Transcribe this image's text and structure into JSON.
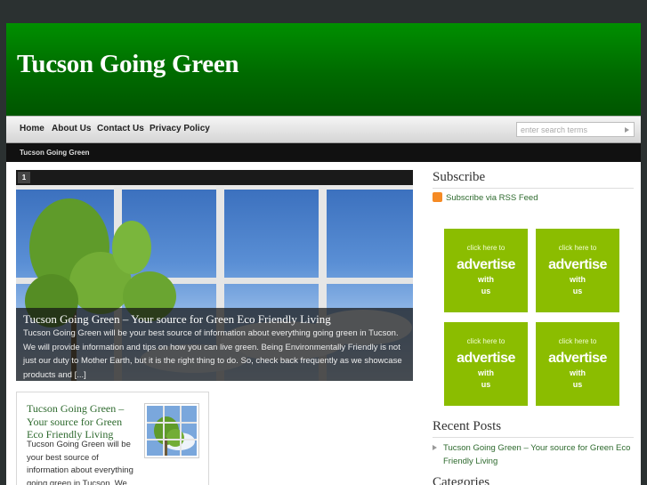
{
  "site": {
    "title": "Tucson Going Green"
  },
  "nav": {
    "items": [
      "Home",
      "About Us",
      "Contact Us",
      "Privacy Policy"
    ]
  },
  "search": {
    "placeholder": "enter search terms"
  },
  "breadcrumb": "Tucson Going Green",
  "slider": {
    "index": "1",
    "caption_title": "Tucson Going Green – Your source for Green Eco Friendly Living",
    "caption_text": "Tucson Going Green will be your best source of information about everything going green in Tucson.  We will provide information and tips on how you can live green.  Being Environmentally Friendly is not just our duty to Mother Earth, but it is the right thing to do.  So, check back frequently as we showcase products and [...]"
  },
  "post": {
    "title": "Tucson Going Green – Your source for Green Eco Friendly Living",
    "excerpt": "Tucson Going Green will be your best source of information about everything going green in Tucson.  We will provide"
  },
  "sidebar": {
    "subscribe_title": "Subscribe",
    "rss_label": "Subscribe via RSS Feed",
    "ads": [
      {
        "l1": "click here to",
        "l2": "advertise",
        "l3": "with",
        "l4": "us"
      },
      {
        "l1": "click here to",
        "l2": "advertise",
        "l3": "with",
        "l4": "us"
      },
      {
        "l1": "click here to",
        "l2": "advertise",
        "l3": "with",
        "l4": "us"
      },
      {
        "l1": "click here to",
        "l2": "advertise",
        "l3": "with",
        "l4": "us"
      }
    ],
    "recent_title": "Recent Posts",
    "recent_items": [
      "Tucson Going Green – Your source for Green Eco Friendly Living"
    ],
    "categories_title": "Categories"
  },
  "colors": {
    "header_green": "#008f00",
    "link_green": "#2e6a2e",
    "ad_green": "#8bbd00"
  }
}
